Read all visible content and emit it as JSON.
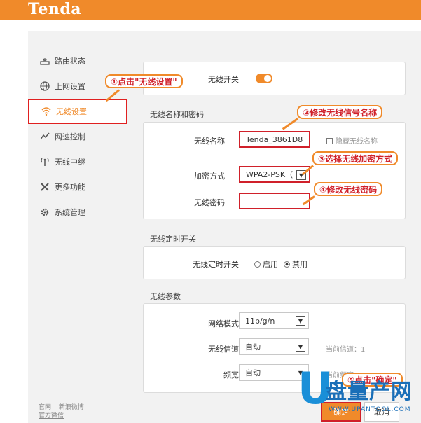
{
  "brand": {
    "logo": "Tenda"
  },
  "sidebar": {
    "items": [
      {
        "label": "路由状态",
        "icon": "router-icon"
      },
      {
        "label": "上网设置",
        "icon": "globe-icon"
      },
      {
        "label": "无线设置",
        "icon": "wifi-icon"
      },
      {
        "label": "网速控制",
        "icon": "speed-chart-icon"
      },
      {
        "label": "无线中继",
        "icon": "repeater-antenna-icon"
      },
      {
        "label": "更多功能",
        "icon": "tools-icon"
      },
      {
        "label": "系统管理",
        "icon": "gear-icon"
      }
    ],
    "active_index": 2,
    "footer_links": [
      "官网",
      "新浪微博",
      "官方微信"
    ]
  },
  "wireless_switch": {
    "label": "无线开关",
    "enabled": true
  },
  "ssid_section": {
    "title": "无线名称和密码",
    "ssid_label": "无线名称",
    "ssid_value": "Tenda_3861D8",
    "hide_ssid_label": "隐藏无线名称",
    "encryption_label": "加密方式",
    "encryption_value": "WPA2-PSK（",
    "password_label": "无线密码",
    "password_value": ""
  },
  "schedule_section": {
    "title": "无线定时开关",
    "label": "无线定时开关",
    "opt_enable": "启用",
    "opt_disable": "禁用",
    "selected": "禁用"
  },
  "params_section": {
    "title": "无线参数",
    "mode_label": "网络模式",
    "mode_value": "11b/g/n",
    "channel_label": "无线信道",
    "channel_value": "自动",
    "current_channel": "当前信道：1",
    "bandwidth_label": "频宽",
    "bandwidth_value": "自动",
    "current_bandwidth": "当前频宽：40M"
  },
  "actions": {
    "ok": "确定",
    "cancel": "取消"
  },
  "callouts": {
    "c1": "①点击\"无线设置\"",
    "c2": "②修改无线信号名称",
    "c3": "③选择无线加密方式",
    "c4": "④修改无线密码",
    "c5": "⑤点击\"确定\""
  },
  "watermark": {
    "main": "盘量产网",
    "sub": "WWW.UPANTOOL.COM"
  },
  "colors": {
    "brand_orange": "#f08a2a",
    "highlight_red": "#d0202a",
    "watermark_blue": "#1a6fb8"
  }
}
